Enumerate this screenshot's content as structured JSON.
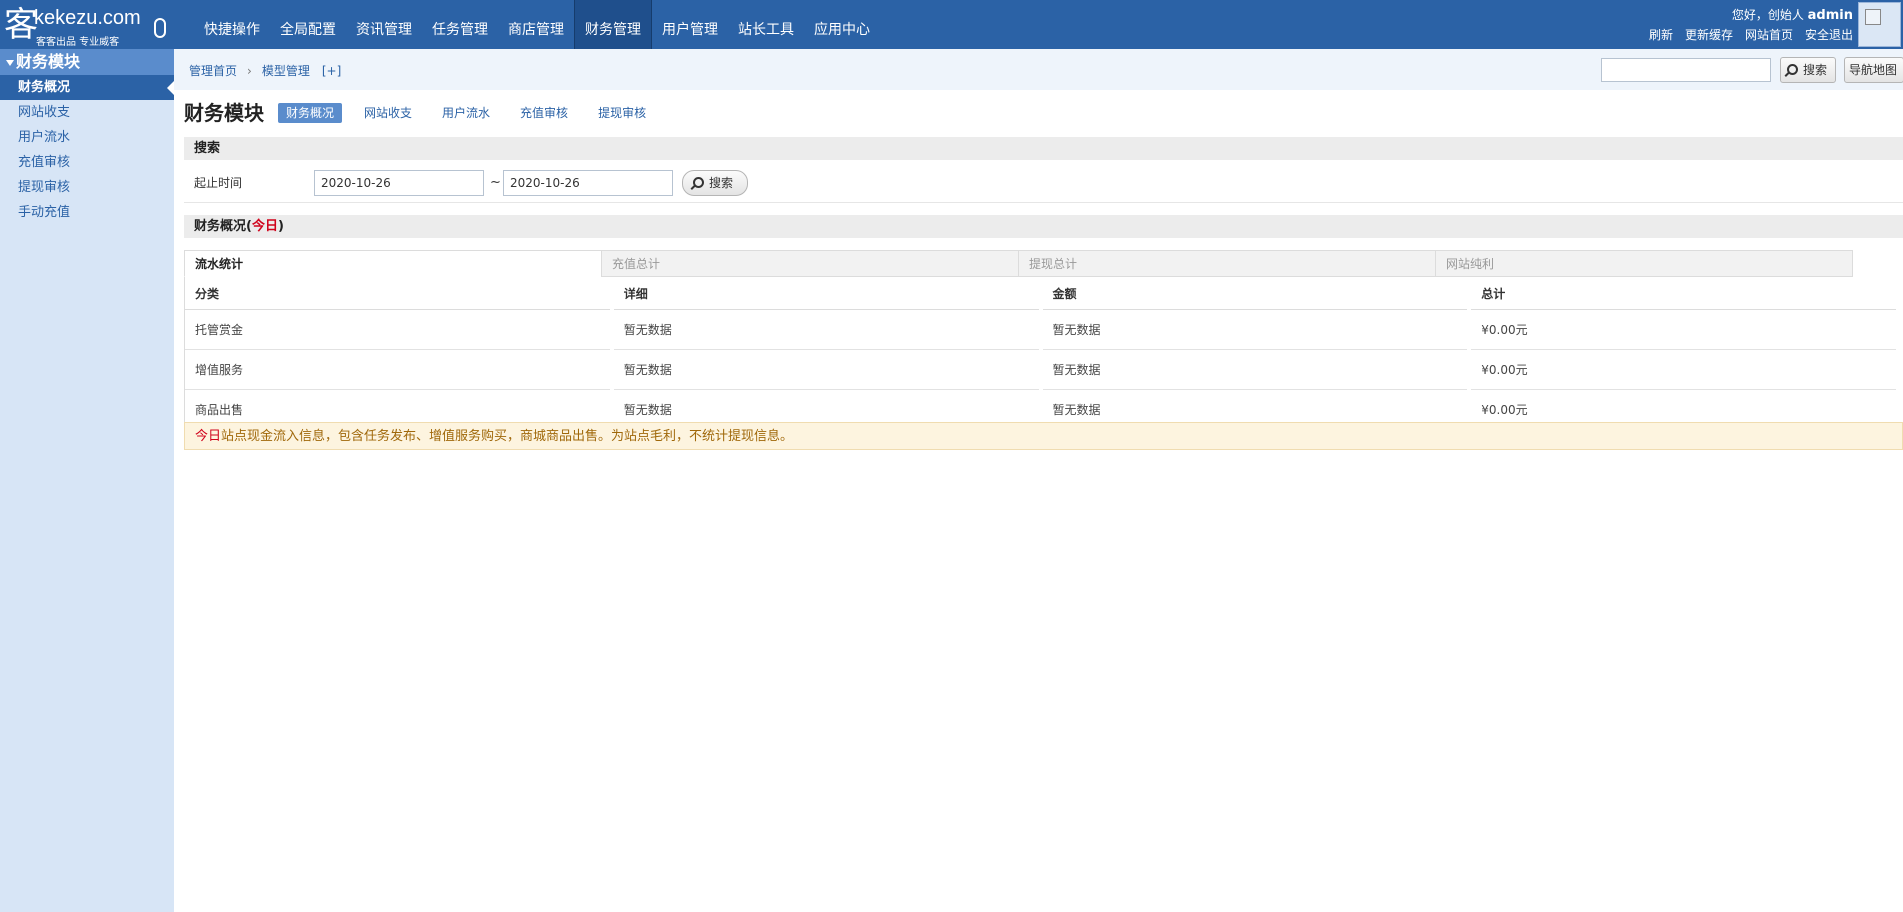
{
  "header": {
    "logo": {
      "domain": "kekezu.com",
      "slogan": "客客出品 专业威客"
    },
    "nav": [
      "快捷操作",
      "全局配置",
      "资讯管理",
      "任务管理",
      "商店管理",
      "财务管理",
      "用户管理",
      "站长工具",
      "应用中心"
    ],
    "active_nav": "财务管理",
    "greeting_prefix": "您好，创始人",
    "username": "admin",
    "links": [
      "刷新",
      "更新缓存",
      "网站首页",
      "安全退出"
    ]
  },
  "sidebar": {
    "title": "财务模块",
    "items": [
      "财务概况",
      "网站收支",
      "用户流水",
      "充值审核",
      "提现审核",
      "手动充值"
    ],
    "active": "财务概况"
  },
  "crumb": {
    "items": [
      "管理首页",
      "模型管理"
    ],
    "add": "[+]",
    "search_button": "搜索",
    "navmap_button": "导航地图"
  },
  "page": {
    "title": "财务模块",
    "subnav": [
      "财务概况",
      "网站收支",
      "用户流水",
      "充值审核",
      "提现审核"
    ],
    "active_subnav": "财务概况"
  },
  "search": {
    "heading": "搜索",
    "label": "起止时间",
    "start_date": "2020-10-26",
    "end_date": "2020-10-26",
    "separator": "~",
    "button": "搜索"
  },
  "overview": {
    "heading_prefix": "财务概况(",
    "heading_today": "今日",
    "heading_suffix": ")",
    "tabs": [
      "流水统计",
      "充值总计",
      "提现总计",
      "网站纯利"
    ],
    "active_tab": "流水统计",
    "columns": [
      "分类",
      "详细",
      "金额",
      "总计"
    ],
    "rows": [
      [
        "托管赏金",
        "暂无数据",
        "暂无数据",
        "¥0.00元"
      ],
      [
        "增值服务",
        "暂无数据",
        "暂无数据",
        "¥0.00元"
      ],
      [
        "商品出售",
        "暂无数据",
        "暂无数据",
        "¥0.00元"
      ]
    ],
    "notice_today": "今日",
    "notice_text": "站点现金流入信息，包含任务发布、增值服务购买，商城商品出售。为站点毛利，不统计提现信息。"
  },
  "colors": {
    "brand": "#2b62a6",
    "sidebar_bg": "#d7e5f6",
    "accent": "#5a8ccc",
    "today_red": "#d0021b"
  }
}
